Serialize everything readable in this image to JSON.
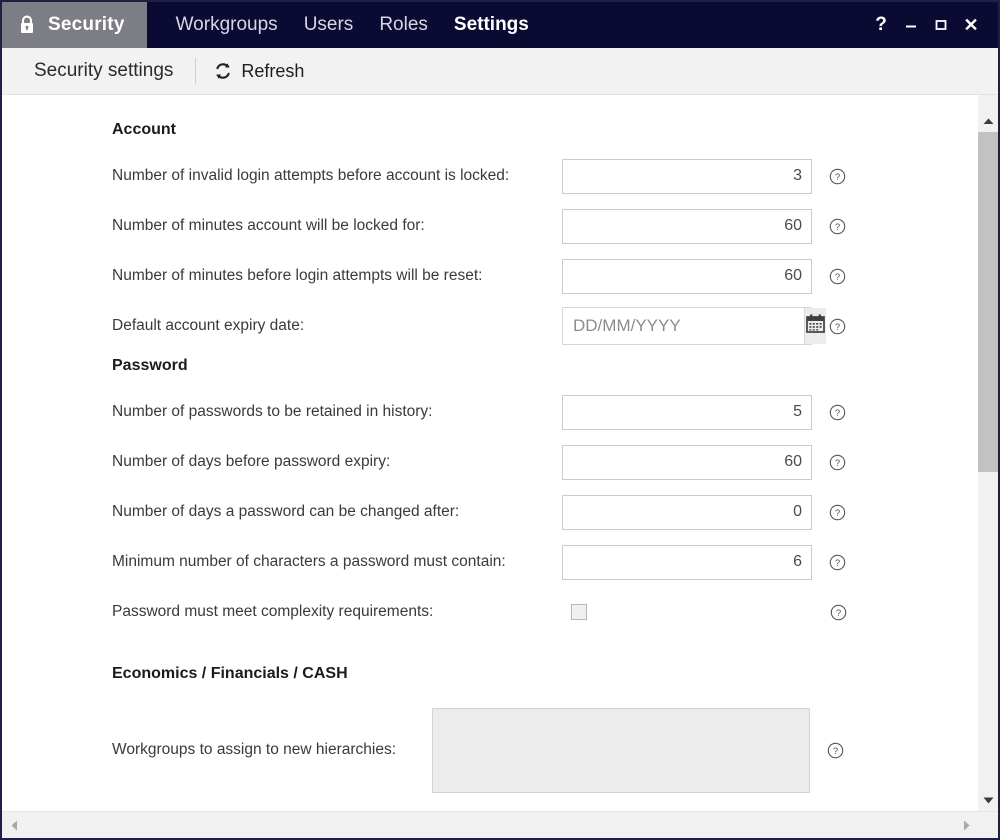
{
  "window": {
    "app_tab_label": "Security",
    "app_tab_icon": "lock-icon",
    "tabs": [
      {
        "label": "Workgroups",
        "active": false
      },
      {
        "label": "Users",
        "active": false
      },
      {
        "label": "Roles",
        "active": false
      },
      {
        "label": "Settings",
        "active": true
      }
    ],
    "controls": {
      "help": "?",
      "minimize": "–",
      "maximize": "☐",
      "close": "✕"
    },
    "colors": {
      "titlebar_bg": "#0a0a32",
      "app_tab_bg": "#7d7d85",
      "toolbar_bg": "#f2f2f2",
      "border": "#1f1f4a",
      "field_border": "#c8cbd4",
      "disabled_field_bg": "#ececec"
    }
  },
  "toolbar": {
    "title": "Security settings",
    "refresh_label": "Refresh",
    "refresh_icon": "refresh-icon"
  },
  "sections": {
    "account": {
      "title": "Account",
      "rows": [
        {
          "label": "Number of invalid login attempts before account is locked:",
          "value": "3",
          "type": "number"
        },
        {
          "label": "Number of minutes account will be locked for:",
          "value": "60",
          "type": "number"
        },
        {
          "label": "Number of minutes before login attempts will be reset:",
          "value": "60",
          "type": "number"
        },
        {
          "label": "Default account expiry date:",
          "value": "",
          "placeholder": "DD/MM/YYYY",
          "type": "date"
        }
      ]
    },
    "password": {
      "title": "Password",
      "rows": [
        {
          "label": "Number of passwords to be retained in history:",
          "value": "5",
          "type": "number"
        },
        {
          "label": "Number of days before password expiry:",
          "value": "60",
          "type": "number"
        },
        {
          "label": "Number of days a password can be changed after:",
          "value": "0",
          "type": "number"
        },
        {
          "label": "Minimum number of characters a password must contain:",
          "value": "6",
          "type": "number"
        },
        {
          "label": "Password must meet complexity requirements:",
          "value": "",
          "checked": false,
          "type": "checkbox"
        }
      ]
    },
    "economics": {
      "title": "Economics / Financials / CASH",
      "rows": [
        {
          "label": "Workgroups to assign to new hierarchies:",
          "value": "",
          "type": "textarea"
        }
      ]
    }
  },
  "icons": {
    "help": "?",
    "calendar": "calendar-icon",
    "scroll_up": "chevron-up-icon",
    "scroll_down": "chevron-down-icon",
    "scroll_left": "chevron-left-icon",
    "scroll_right": "chevron-right-icon"
  }
}
